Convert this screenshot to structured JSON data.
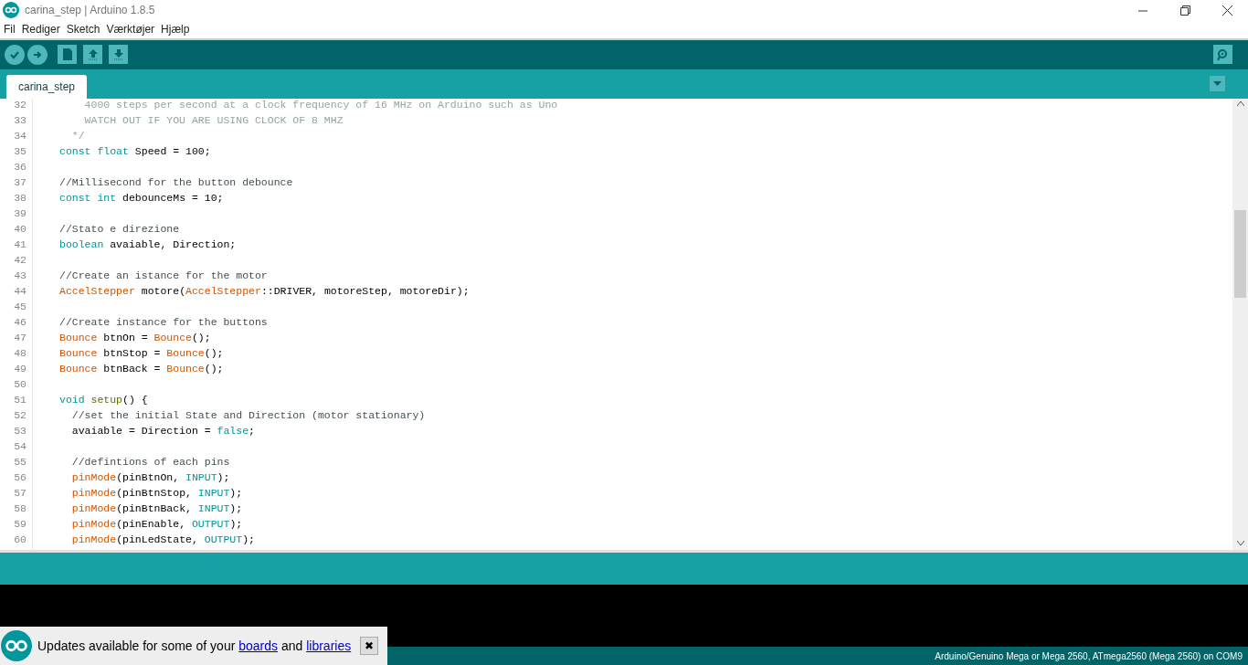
{
  "window": {
    "title": "carina_step | Arduino 1.8.5"
  },
  "menu": [
    "Fil",
    "Rediger",
    "Sketch",
    "Værktøjer",
    "Hjælp"
  ],
  "tabs": [
    {
      "label": "carina_step",
      "selected": true
    }
  ],
  "code": [
    {
      "num": "32",
      "tokens": [
        {
          "text": "    4000 steps per second at a clock frequency of 16 MHz on Arduino such as Uno",
          "kind": "doc"
        }
      ]
    },
    {
      "num": "33",
      "tokens": [
        {
          "text": "    WATCH OUT IF YOU ARE USING CLOCK OF 8 MHZ",
          "kind": "doc"
        }
      ]
    },
    {
      "num": "34",
      "tokens": [
        {
          "text": "  */",
          "kind": "doc"
        }
      ]
    },
    {
      "num": "35",
      "tokens": [
        {
          "text": "const float",
          "kind": "keyword"
        },
        {
          "text": " Speed = 100;",
          "kind": "plain"
        }
      ]
    },
    {
      "num": "36"
    },
    {
      "num": "37",
      "tokens": [
        {
          "text": "//Millisecond for the button debounce",
          "kind": "comment"
        }
      ]
    },
    {
      "num": "38",
      "tokens": [
        {
          "text": "const int",
          "kind": "keyword"
        },
        {
          "text": " debounceMs = 10;",
          "kind": "plain"
        }
      ]
    },
    {
      "num": "39"
    },
    {
      "num": "40",
      "tokens": [
        {
          "text": "//Stato e direzione",
          "kind": "comment"
        }
      ]
    },
    {
      "num": "41",
      "tokens": [
        {
          "text": "boolean",
          "kind": "keyword"
        },
        {
          "text": " avaiable, Direction;",
          "kind": "plain"
        }
      ]
    },
    {
      "num": "42"
    },
    {
      "num": "43",
      "tokens": [
        {
          "text": "//Create an istance for the motor",
          "kind": "comment"
        }
      ]
    },
    {
      "num": "44",
      "tokens": [
        {
          "text": "AccelStepper",
          "kind": "type"
        },
        {
          "text": " motore(",
          "kind": "plain"
        },
        {
          "text": "AccelStepper",
          "kind": "type"
        },
        {
          "text": "::DRIVER, motoreStep, motoreDir);",
          "kind": "plain"
        }
      ]
    },
    {
      "num": "45"
    },
    {
      "num": "46",
      "tokens": [
        {
          "text": "//Create instance for the buttons",
          "kind": "comment"
        }
      ]
    },
    {
      "num": "47",
      "tokens": [
        {
          "text": "Bounce",
          "kind": "type"
        },
        {
          "text": " btnOn = ",
          "kind": "plain"
        },
        {
          "text": "Bounce",
          "kind": "type"
        },
        {
          "text": "();",
          "kind": "plain"
        }
      ]
    },
    {
      "num": "48",
      "tokens": [
        {
          "text": "Bounce",
          "kind": "type"
        },
        {
          "text": " btnStop = ",
          "kind": "plain"
        },
        {
          "text": "Bounce",
          "kind": "type"
        },
        {
          "text": "();",
          "kind": "plain"
        }
      ]
    },
    {
      "num": "49",
      "tokens": [
        {
          "text": "Bounce",
          "kind": "type"
        },
        {
          "text": " btnBack = ",
          "kind": "plain"
        },
        {
          "text": "Bounce",
          "kind": "type"
        },
        {
          "text": "();",
          "kind": "plain"
        }
      ]
    },
    {
      "num": "50"
    },
    {
      "num": "51",
      "tokens": [
        {
          "text": "void",
          "kind": "keyword"
        },
        {
          "text": " setup",
          "kind": "function"
        },
        {
          "text": "() {",
          "kind": "plain"
        }
      ]
    },
    {
      "num": "52",
      "tokens": [
        {
          "text": "  //set the initial State and Direction (motor stationary)",
          "kind": "comment"
        }
      ]
    },
    {
      "num": "53",
      "tokens": [
        {
          "text": "  avaiable = Direction = ",
          "kind": "plain"
        },
        {
          "text": "false",
          "kind": "keyword"
        },
        {
          "text": ";",
          "kind": "plain"
        }
      ]
    },
    {
      "num": "54"
    },
    {
      "num": "55",
      "tokens": [
        {
          "text": "  //defintions of each pins",
          "kind": "comment"
        }
      ]
    },
    {
      "num": "56",
      "tokens": [
        {
          "text": "  pinMode",
          "kind": "type"
        },
        {
          "text": "(pinBtnOn, ",
          "kind": "plain"
        },
        {
          "text": "INPUT",
          "kind": "keyword"
        },
        {
          "text": ");",
          "kind": "plain"
        }
      ]
    },
    {
      "num": "57",
      "tokens": [
        {
          "text": "  pinMode",
          "kind": "type"
        },
        {
          "text": "(pinBtnStop, ",
          "kind": "plain"
        },
        {
          "text": "INPUT",
          "kind": "keyword"
        },
        {
          "text": ");",
          "kind": "plain"
        }
      ]
    },
    {
      "num": "58",
      "tokens": [
        {
          "text": "  pinMode",
          "kind": "type"
        },
        {
          "text": "(pinBtnBack, ",
          "kind": "plain"
        },
        {
          "text": "INPUT",
          "kind": "keyword"
        },
        {
          "text": ");",
          "kind": "plain"
        }
      ]
    },
    {
      "num": "59",
      "tokens": [
        {
          "text": "  pinMode",
          "kind": "type"
        },
        {
          "text": "(pinEnable, ",
          "kind": "plain"
        },
        {
          "text": "OUTPUT",
          "kind": "keyword"
        },
        {
          "text": ");",
          "kind": "plain"
        }
      ]
    },
    {
      "num": "60",
      "tokens": [
        {
          "text": "  pinMode",
          "kind": "type"
        },
        {
          "text": "(pinLedState, ",
          "kind": "plain"
        },
        {
          "text": "OUTPUT",
          "kind": "keyword"
        },
        {
          "text": ");",
          "kind": "plain"
        }
      ]
    }
  ],
  "notification": {
    "parts": [
      {
        "text": "Updates available for some of your ",
        "kind": "text"
      },
      {
        "text": "boards",
        "kind": "link"
      },
      {
        "text": " and ",
        "kind": "text"
      },
      {
        "text": "libraries",
        "kind": "link"
      }
    ],
    "close": "✖"
  },
  "status_bar": {
    "board": "Arduino/Genuino Mega or Mega 2560, ATmega2560 (Mega 2560) on COM9"
  }
}
